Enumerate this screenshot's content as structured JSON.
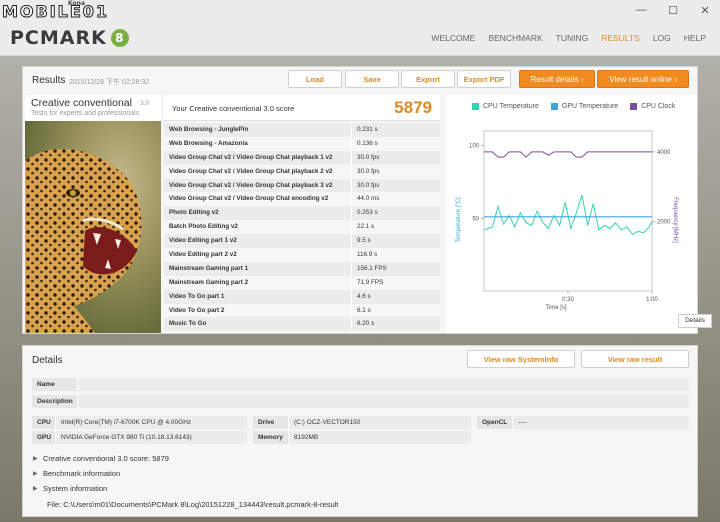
{
  "watermark": {
    "text": "MOBILE01",
    "small": "Kona"
  },
  "window_controls": {
    "minimize": "—",
    "maximize": "☐",
    "close": "✕"
  },
  "app": {
    "logo_text": "PCMARK",
    "logo_badge": "8"
  },
  "nav": {
    "items": [
      "WELCOME",
      "BENCHMARK",
      "TUNING",
      "RESULTS",
      "LOG",
      "HELP"
    ],
    "active": "RESULTS"
  },
  "results": {
    "title": "Results",
    "date": "2015/12/28 下午 02:28:32",
    "buttons": {
      "load": "Load",
      "save": "Save",
      "export": "Export",
      "export_pdf": "Export PDF",
      "result_details": "Result details ›",
      "view_online": "View result online ›"
    },
    "test": {
      "name": "Creative conventional",
      "version": "3.0",
      "subtitle": "Tests for experts and professionals"
    },
    "score_label": "Your Creative conventional 3.0 score",
    "score": "5879",
    "subtests": [
      {
        "name": "Web Browsing - JunglePin",
        "value": "0.231 s"
      },
      {
        "name": "Web Browsing - Amazonia",
        "value": "0.136 s"
      },
      {
        "name": "Video Group Chat v2 / Video Group Chat playback 1 v2",
        "value": "30.0 fps"
      },
      {
        "name": "Video Group Chat v2 / Video Group Chat playback 2 v2",
        "value": "30.0 fps"
      },
      {
        "name": "Video Group Chat v2 / Video Group Chat playback 3 v2",
        "value": "30.0 fps"
      },
      {
        "name": "Video Group Chat v2 / Video Group Chat encoding v2",
        "value": "44.0 ms"
      },
      {
        "name": "Photo Editing v2",
        "value": "0.253 s"
      },
      {
        "name": "Batch Photo Editing v2",
        "value": "22.1 s"
      },
      {
        "name": "Video Editing part 1 v2",
        "value": "9.5 s"
      },
      {
        "name": "Video Editing part 2 v2",
        "value": "116.9 s"
      },
      {
        "name": "Mainstream Gaming part 1",
        "value": "156.1 FPS"
      },
      {
        "name": "Mainstream Gaming part 2",
        "value": "71.9 FPS"
      },
      {
        "name": "Video To Go part 1",
        "value": "4.6 s"
      },
      {
        "name": "Video To Go part 2",
        "value": "6.1 s"
      },
      {
        "name": "Music To Go",
        "value": "6.20 s"
      }
    ],
    "details_button": "Details"
  },
  "chart_data": {
    "type": "line",
    "legend": [
      "CPU Temperature",
      "GPU Temperature",
      "CPU Clock"
    ],
    "colors": {
      "cpu_temp": "#36d1b4",
      "gpu_temp": "#3aa6d8",
      "cpu_clock": "#7a4fa0"
    },
    "xlabel": "Time [s]",
    "x_ticks": [
      "0:30",
      "1:00"
    ],
    "ylabel_left": "Temperature [°C]",
    "y_left_ticks": [
      "100",
      "50"
    ],
    "ylim_left": [
      0,
      110
    ],
    "ylabel_right": "Frequency [MHz]",
    "y_right_ticks": [
      "4000",
      "2000"
    ],
    "ylim_right": [
      0,
      4600
    ],
    "xlim": [
      0,
      60
    ],
    "series": [
      {
        "name": "CPU Temperature",
        "x": [
          0,
          3,
          5,
          7,
          9,
          11,
          13,
          15,
          17,
          19,
          21,
          23,
          25,
          27,
          29,
          31,
          33,
          35,
          37,
          39,
          41,
          43,
          45,
          47,
          49,
          51,
          53,
          55,
          57,
          59,
          60
        ],
        "values": [
          42,
          44,
          58,
          46,
          52,
          44,
          54,
          47,
          45,
          55,
          47,
          43,
          52,
          45,
          61,
          43,
          54,
          66,
          45,
          60,
          42,
          45,
          43,
          47,
          42,
          44,
          39,
          41,
          40,
          44,
          48
        ]
      },
      {
        "name": "GPU Temperature",
        "x": [
          0,
          60
        ],
        "values": [
          51,
          51
        ]
      },
      {
        "name": "CPU Clock",
        "x": [
          0,
          3,
          5,
          7,
          9,
          11,
          13,
          15,
          17,
          19,
          21,
          23,
          25,
          27,
          29,
          31,
          33,
          35,
          37,
          39,
          41,
          43,
          45,
          47,
          49,
          51,
          53,
          55,
          57,
          59,
          60
        ],
        "values": [
          4000,
          4000,
          3850,
          3850,
          4000,
          4000,
          4000,
          3850,
          4000,
          4000,
          4000,
          3900,
          4000,
          4000,
          4000,
          4000,
          3850,
          3850,
          4000,
          4000,
          4000,
          4000,
          4000,
          4000,
          4000,
          4000,
          4000,
          4000,
          4000,
          4000,
          4000
        ]
      }
    ]
  },
  "details": {
    "title": "Details",
    "view_sysinfo": "View raw SystemInfo",
    "view_result": "View raw result",
    "name_label": "Name",
    "name_value": "",
    "desc_label": "Description",
    "desc_value": "",
    "cpu_label": "CPU",
    "cpu_value": "Intel(R) Core(TM) i7-6700K CPU @ 4.00GHz",
    "gpu_label": "GPU",
    "gpu_value": "NVIDIA GeForce GTX 980 Ti (10.18.13.6143)",
    "drive_label": "Drive",
    "drive_value": "(C:) OCZ-VECTOR150",
    "memory_label": "Memory",
    "memory_value": "8192MB",
    "opencl_label": "OpenCL",
    "opencl_value": "----",
    "expand_score": "Creative conventional 3.0 score: 5879",
    "expand_benchmark": "Benchmark information",
    "expand_system": "System information",
    "file": "File: C:\\Users\\m01\\Documents\\PCMark 8\\Log\\20151228_134443\\result.pcmark-8-result"
  }
}
